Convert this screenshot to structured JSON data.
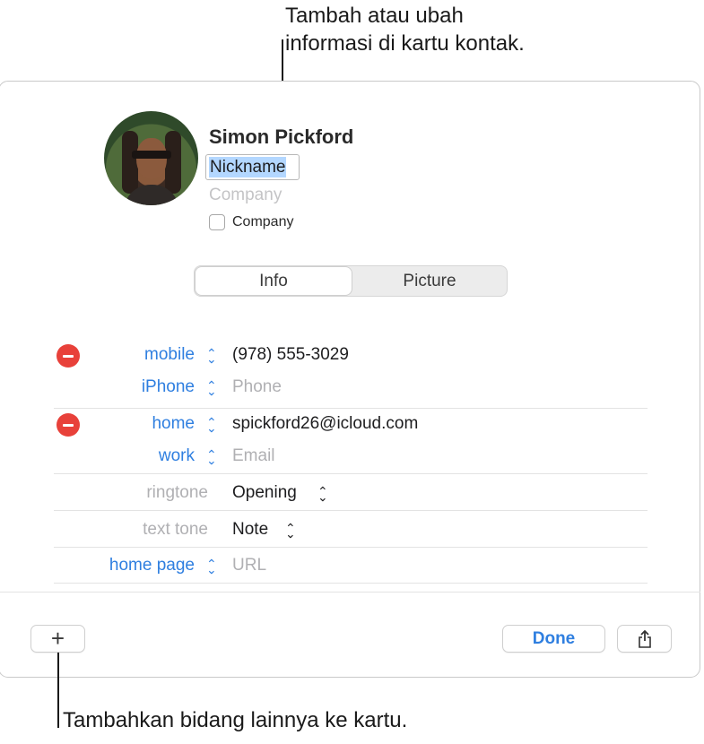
{
  "callouts": {
    "top_line1": "Tambah atau ubah",
    "top_line2": "informasi di kartu kontak.",
    "bottom": "Tambahkan bidang lainnya ke kartu."
  },
  "contact": {
    "name": "Simon Pickford",
    "nickname": "Nickname",
    "company_placeholder": "Company",
    "company_checkbox_label": "Company",
    "company_checked": false
  },
  "tabs": [
    {
      "label": "Info",
      "active": true
    },
    {
      "label": "Picture",
      "active": false
    }
  ],
  "fields": {
    "phone1": {
      "label": "mobile",
      "value": "(978) 555-3029"
    },
    "phone2": {
      "label": "iPhone",
      "placeholder": "Phone"
    },
    "email1": {
      "label": "home",
      "value": "spickford26@icloud.com"
    },
    "email2": {
      "label": "work",
      "placeholder": "Email"
    },
    "ringtone": {
      "label": "ringtone",
      "value": "Opening"
    },
    "texttone": {
      "label": "text tone",
      "value": "Note"
    },
    "homepage": {
      "label": "home page",
      "placeholder": "URL"
    }
  },
  "footer": {
    "add_label": "+",
    "done_label": "Done",
    "share_icon": "share-icon"
  },
  "colors": {
    "accent": "#2f7fe0",
    "delete": "#e8413a",
    "selection": "#b3d7ff"
  }
}
